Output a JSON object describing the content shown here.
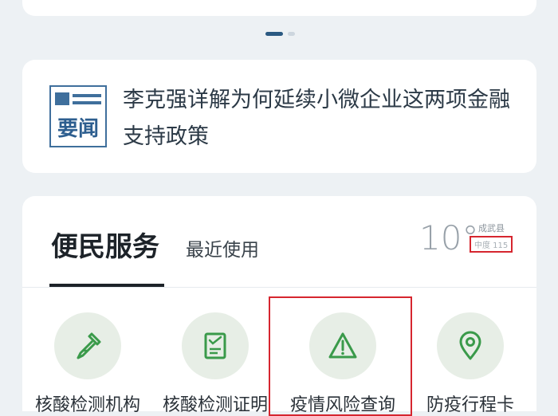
{
  "colors": {
    "background": "#edf1f4",
    "card": "#ffffff",
    "accent_blue": "#2b5a82",
    "icon_green": "#3a9a4a",
    "icon_bg": "#e7eee6",
    "highlight_red": "#d6262f"
  },
  "carousel": {
    "active_index": 0,
    "count": 2
  },
  "news": {
    "badge_label": "要闻",
    "title": "李克强详解为何延续小微企业这两项金融支持政策"
  },
  "services": {
    "title": "便民服务",
    "tab_recent": "最近使用",
    "weather": {
      "temperature": "10°",
      "city": "成武县",
      "aqi": "中度 115"
    },
    "items": [
      {
        "label": "核酸检测机构",
        "icon": "dropper-icon"
      },
      {
        "label": "核酸检测证明",
        "icon": "document-check-icon"
      },
      {
        "label": "疫情风险查询",
        "icon": "warning-icon"
      },
      {
        "label": "防疫行程卡",
        "icon": "location-pin-icon"
      }
    ]
  }
}
